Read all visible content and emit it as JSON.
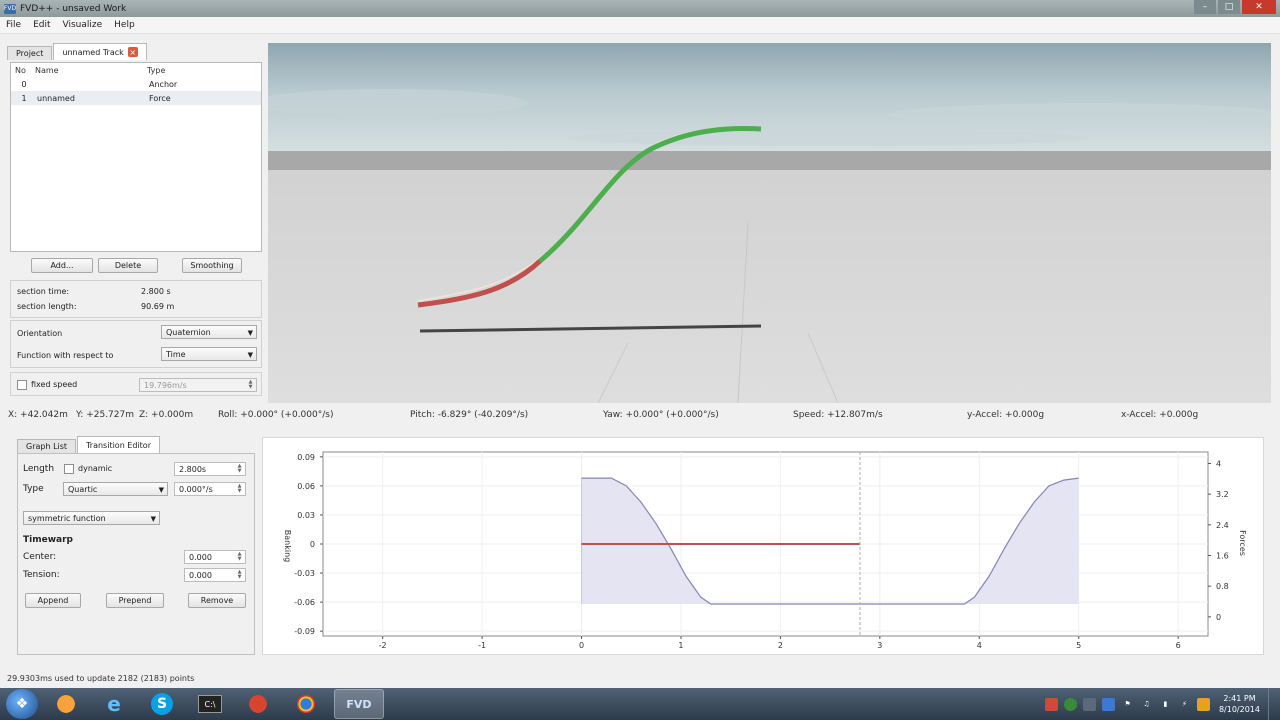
{
  "window": {
    "title": "FVD++ - unsaved Work",
    "app_icon": "FVD"
  },
  "menu": [
    "File",
    "Edit",
    "Visualize",
    "Help"
  ],
  "project_tabs": {
    "project_label": "Project",
    "track_label": "unnamed Track"
  },
  "track_list": {
    "headers": {
      "no": "No",
      "name": "Name",
      "type": "Type"
    },
    "rows": [
      {
        "no": "0",
        "name": "",
        "type": "Anchor"
      },
      {
        "no": "1",
        "name": "unnamed",
        "type": "Force"
      }
    ]
  },
  "list_buttons": {
    "add": "Add...",
    "delete": "Delete",
    "smoothing": "Smoothing"
  },
  "section_info": {
    "time_label": "section time:",
    "time_value": "2.800 s",
    "length_label": "section length:",
    "length_value": "90.69 m"
  },
  "settings": {
    "orientation_label": "Orientation",
    "orientation_value": "Quaternion",
    "function_label": "Function with respect to",
    "function_value": "Time",
    "fixed_speed_label": "fixed speed",
    "fixed_speed_value": "19.796m/s"
  },
  "status": {
    "x": "X: +42.042m",
    "y": "Y: +25.727m",
    "z": "Z: +0.000m",
    "roll": "Roll: +0.000° (+0.000°/s)",
    "pitch": "Pitch: -6.829° (-40.209°/s)",
    "yaw": "Yaw: +0.000° (+0.000°/s)",
    "speed": "Speed: +12.807m/s",
    "y_accel": "y-Accel: +0.000g",
    "x_accel": "x-Accel: +0.000g"
  },
  "editor_tabs": {
    "graph_list": "Graph List",
    "transition_editor": "Transition Editor"
  },
  "transition_editor": {
    "length_label": "Length",
    "dynamic_label": "dynamic",
    "length_value": "2.800s",
    "type_label": "Type",
    "type_value": "Quartic",
    "type_rate": "0.000°/s",
    "symmetric_value": "symmetric function",
    "timewarp_title": "Timewarp",
    "center_label": "Center:",
    "center_value": "0.000",
    "tension_label": "Tension:",
    "tension_value": "0.000",
    "append": "Append",
    "prepend": "Prepend",
    "remove": "Remove"
  },
  "chart_data": {
    "type": "line",
    "ylabel": "Banking",
    "y2label": "Forces",
    "xlim": [
      -2.6,
      6.3
    ],
    "ylim": [
      -0.095,
      0.095
    ],
    "y2lim": [
      -0.5,
      4.3
    ],
    "x_ticks": [
      -2,
      -1,
      0,
      1,
      2,
      3,
      4,
      5,
      6
    ],
    "y_ticks": [
      0.09,
      0.06,
      0.03,
      0,
      -0.03,
      -0.06,
      -0.09
    ],
    "y_tick_labels": [
      "0.09",
      "0.06",
      "0.03",
      "0",
      "-0.03",
      "-0.06",
      "-0.09"
    ],
    "y2_ticks": [
      4,
      3.2,
      2.4,
      1.6,
      0.8,
      0
    ],
    "y2_tick_labels": [
      "4",
      "3.2",
      "2.4",
      "1.6",
      "0.8",
      "0"
    ],
    "series": [
      {
        "x": [
          0,
          0.3,
          0.45,
          0.6,
          0.75,
          0.9,
          1.05,
          1.2,
          1.3,
          3.85,
          3.95,
          4.1,
          4.25,
          4.4,
          4.55,
          4.7,
          4.85,
          5.0
        ],
        "values": [
          0.068,
          0.068,
          0.06,
          0.043,
          0.021,
          -0.005,
          -0.033,
          -0.055,
          -0.062,
          -0.062,
          -0.055,
          -0.033,
          -0.005,
          0.021,
          0.043,
          0.06,
          0.066,
          0.068
        ]
      },
      {
        "x": [
          0,
          2.8
        ],
        "values": [
          0,
          0
        ]
      }
    ],
    "marker_x": 2.8,
    "colors": {
      "banking": "#8585b5",
      "banking_fill": "#e4e4f2",
      "force": "#c0504d",
      "marker": "#b0b0b0"
    }
  },
  "log_text": "29.9303ms used to update 2182 (2183) points",
  "taskbar": {
    "apps": [
      "firefox-icon",
      "ie-icon",
      "skype-icon",
      "terminal-icon",
      "firefox-dev-icon",
      "chrome-icon",
      "fvd-icon"
    ],
    "fvd_label": "FVD",
    "clock_time": "2:41 PM",
    "clock_date": "8/10/2014"
  }
}
